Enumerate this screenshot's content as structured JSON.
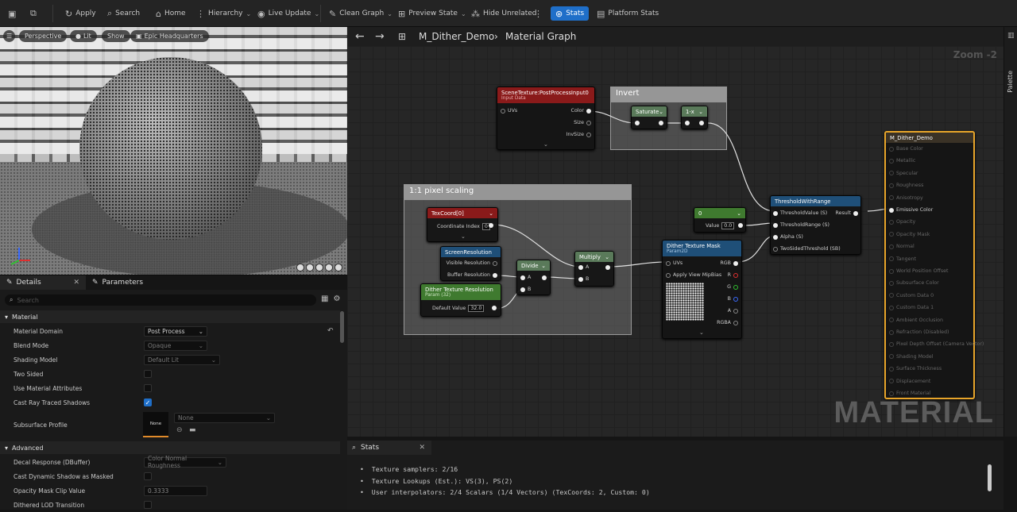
{
  "toolbar": {
    "apply": "Apply",
    "search": "Search",
    "home": "Home",
    "hierarchy": "Hierarchy",
    "live_update": "Live Update",
    "clean_graph": "Clean Graph",
    "preview_state": "Preview State",
    "hide_unrelated": "Hide Unrelated",
    "stats": "Stats",
    "platform_stats": "Platform Stats"
  },
  "viewport": {
    "perspective": "Perspective",
    "lit": "Lit",
    "show": "Show",
    "preview_mesh": "Epic Headquarters"
  },
  "details": {
    "tab_details": "Details",
    "tab_parameters": "Parameters",
    "search_placeholder": "Search",
    "sections": {
      "material": "Material",
      "advanced": "Advanced"
    },
    "rows": {
      "material_domain": {
        "label": "Material Domain",
        "value": "Post Process"
      },
      "blend_mode": {
        "label": "Blend Mode",
        "value": "Opaque"
      },
      "shading_model": {
        "label": "Shading Model",
        "value": "Default Lit"
      },
      "two_sided": {
        "label": "Two Sided"
      },
      "use_material_attributes": {
        "label": "Use Material Attributes"
      },
      "cast_ray_traced_shadows": {
        "label": "Cast Ray Traced Shadows"
      },
      "subsurface_profile": {
        "label": "Subsurface Profile",
        "thumb": "None",
        "value": "None"
      },
      "decal_response": {
        "label": "Decal Response (DBuffer)",
        "value": "Color Normal Roughness"
      },
      "cast_dynamic_shadow": {
        "label": "Cast Dynamic Shadow as Masked"
      },
      "opacity_mask_clip": {
        "label": "Opacity Mask Clip Value",
        "value": "0.3333"
      },
      "dithered_lod": {
        "label": "Dithered LOD Transition"
      }
    }
  },
  "graph": {
    "breadcrumb_asset": "M_Dither_Demo",
    "breadcrumb_graph": "Material Graph",
    "zoom": "Zoom -2",
    "watermark": "MATERIAL",
    "palette": "Palette",
    "comments": {
      "invert": "Invert",
      "pixel": "1:1 pixel scaling"
    },
    "nodes": {
      "scene_texture": {
        "title": "SceneTexture:PostProcessInput0",
        "subtitle": "Input Data",
        "in_uvs": "UVs",
        "out_color": "Color",
        "out_size": "Size",
        "out_invsize": "InvSize"
      },
      "saturate": {
        "title": "Saturate"
      },
      "one_minus": {
        "title": "1-x"
      },
      "texcoord": {
        "title": "TexCoord[0]",
        "coord_label": "Coordinate Index",
        "coord_value": "0"
      },
      "screen_res": {
        "title": "ScreenResolution",
        "visible": "Visible Resolution",
        "buffer": "Buffer Resolution"
      },
      "dither_res": {
        "title": "Dither Texture Resolution",
        "subtitle": "Param (32)",
        "default_label": "Default Value",
        "default_value": "32.0"
      },
      "divide": {
        "title": "Divide",
        "a": "A",
        "b": "B"
      },
      "multiply": {
        "title": "Multiply",
        "a": "A",
        "b": "B"
      },
      "const": {
        "title": "0",
        "value_label": "Value",
        "value": "0.0"
      },
      "dither_mask": {
        "title": "Dither Texture Mask",
        "subtitle": "Param2D",
        "uvs": "UVs",
        "mipbias": "Apply View MipBias",
        "rgb": "RGB",
        "r": "R",
        "g": "G",
        "b": "B",
        "a": "A",
        "rgba": "RGBA"
      },
      "threshold": {
        "title": "ThresholdWithRange",
        "in1": "ThresholdValue (S)",
        "in2": "ThresholdRange (S)",
        "in3": "Alpha (S)",
        "in4": "TwoSidedThreshold (SB)",
        "out": "Result"
      },
      "result": {
        "title": "M_Dither_Demo",
        "pins": [
          "Base Color",
          "Metallic",
          "Specular",
          "Roughness",
          "Anisotropy",
          "Emissive Color",
          "Opacity",
          "Opacity Mask",
          "Normal",
          "Tangent",
          "World Position Offset",
          "Subsurface Color",
          "Custom Data 0",
          "Custom Data 1",
          "Ambient Occlusion",
          "Refraction (Disabled)",
          "Pixel Depth Offset (Camera Vector)",
          "Shading Model",
          "Surface Thickness",
          "Displacement",
          "Front Material"
        ],
        "active_pin": "Emissive Color"
      }
    }
  },
  "stats": {
    "tab": "Stats",
    "lines": [
      "Texture samplers: 2/16",
      "Texture Lookups (Est.): VS(3), PS(2)",
      "User interpolators: 2/4 Scalars (1/4 Vectors) (TexCoords: 2, Custom: 0)"
    ]
  },
  "colors": {
    "accent": "#1f6fc9",
    "scene_header": "#8a1a1a",
    "texcoord_header": "#8a1a1a",
    "screen_header": "#1f4f78",
    "dither_res_header": "#3f7a2f",
    "math_header": "#4a6b4a",
    "result_border": "#e8a52a"
  },
  "icons": [
    "save-icon",
    "browse-icon",
    "apply-icon",
    "search-icon",
    "home-icon",
    "hierarchy-icon",
    "live-update-icon",
    "clean-graph-icon",
    "preview-state-icon",
    "hide-unrelated-icon",
    "stats-icon",
    "platform-stats-icon"
  ]
}
